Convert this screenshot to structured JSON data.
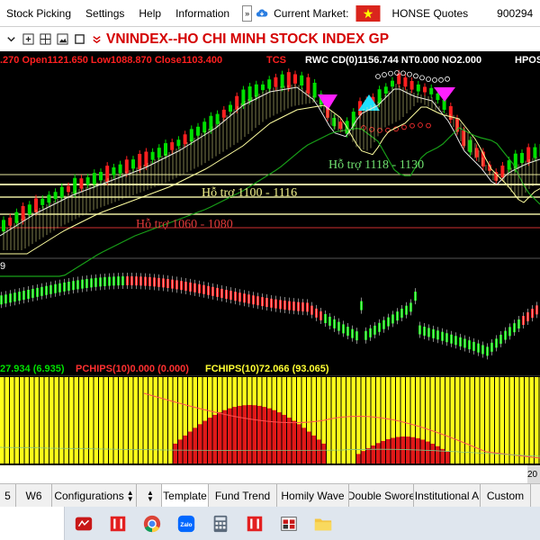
{
  "menu": {
    "items": [
      "Stock Picking",
      "Settings",
      "Help",
      "Information"
    ],
    "scroll_arrow": "»",
    "market_label": "Current Market:",
    "market_value": "HONSE Quotes",
    "code_partial": "900294"
  },
  "title": {
    "icons": [
      "chevron-down-icon",
      "plus-box-icon",
      "grid-icon",
      "image-icon",
      "square-icon",
      "double-chevron-icon"
    ],
    "text": "VNINDEX--HO CHI MINH STOCK INDEX  GP"
  },
  "chart": {
    "ohlc_line": ".270 Open1121.650 Low1088.870 Close1103.400",
    "tcs": "TCS",
    "rwc_line": "RWC CD(0)1156.744 NT0.000 NO2.000",
    "hpos": "HPOS",
    "support_labels": [
      "Hỗ trợ 1118 - 1130",
      "Hỗ trợ 1100 - 1116",
      "Hỗ trợ 1060 - 1080"
    ],
    "mid_label": "9",
    "indicator_line": {
      "part1": "27.934 (6.935)",
      "part2": "PCHIPS(10)0.000 (0.000)",
      "part3": "FCHIPS(10)72.066 (93.065)"
    },
    "corner_label": "20",
    "colors": {
      "up": "#00e000",
      "down": "#ff2020",
      "support": "#e8e8a0",
      "support_red": "#d03030",
      "yellow": "#ffff1a"
    }
  },
  "chart_data": {
    "type": "candlestick",
    "title": "VNINDEX--HO CHI MINH STOCK INDEX  GP",
    "ohlc": {
      "open": 1121.65,
      "low": 1088.87,
      "close": 1103.4
    },
    "support_zones": [
      {
        "label": "Hỗ trợ 1118 - 1130",
        "low": 1118,
        "high": 1130
      },
      {
        "label": "Hỗ trợ 1100 - 1116",
        "low": 1100,
        "high": 1116
      },
      {
        "label": "Hỗ trợ 1060 - 1080",
        "low": 1060,
        "high": 1080
      }
    ],
    "indicators": [
      {
        "name": "RWC CD(0)",
        "value": 1156.744
      },
      {
        "name": "NT",
        "value": 0.0
      },
      {
        "name": "NO",
        "value": 2.0
      },
      {
        "name": "PCHIPS(10)",
        "value": 0.0,
        "change": 0.0
      },
      {
        "name": "FCHIPS(10)",
        "value": 72.066,
        "change": 93.065
      }
    ]
  },
  "tabs": [
    "5",
    "W6",
    "Configurations",
    "Template",
    "Fund Trend",
    "Homily Wave",
    "Double Swore",
    "Institutional A",
    "Custom"
  ],
  "active_tab": "Template",
  "taskbar_icons": [
    "app-red-icon",
    "app-red-chart-icon",
    "chrome-icon",
    "zalo-icon",
    "calculator-icon",
    "app-red-chart-2-icon",
    "app-windows-icon",
    "file-explorer-icon"
  ]
}
